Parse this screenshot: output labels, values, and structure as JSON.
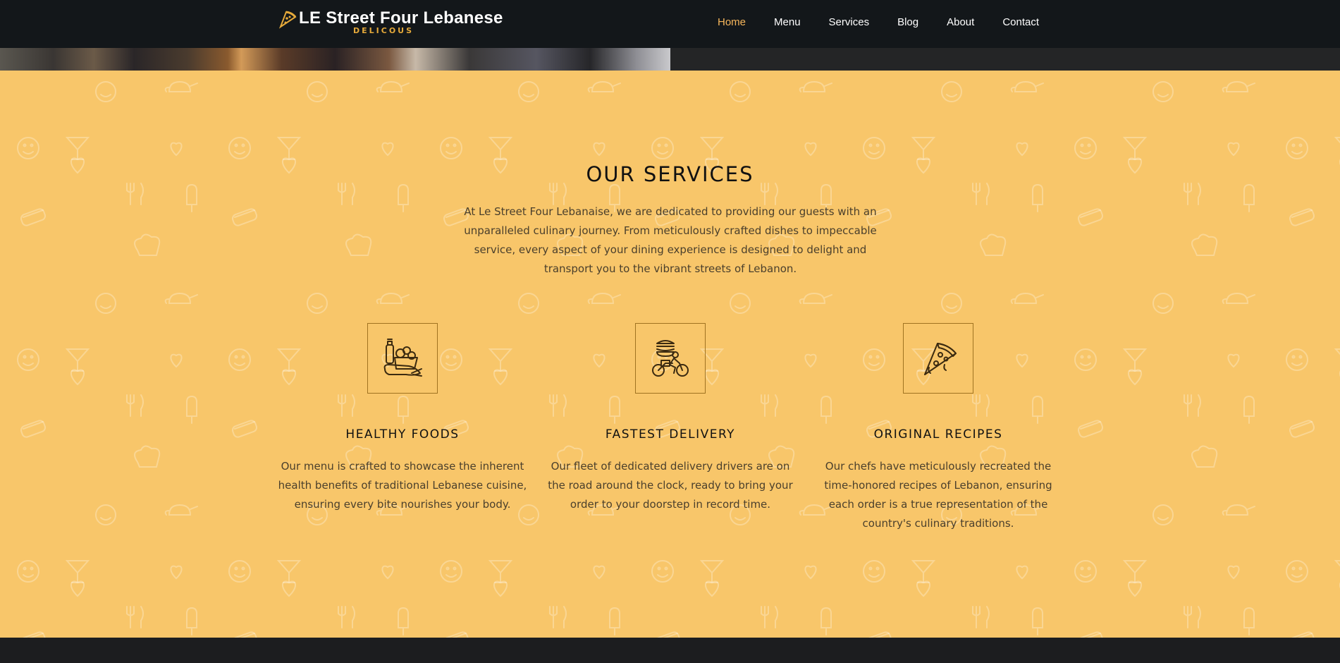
{
  "header": {
    "brand_title": "LE Street Four Lebanese",
    "brand_subtitle": "DELICOUS",
    "nav": [
      {
        "label": "Home",
        "active": true
      },
      {
        "label": "Menu"
      },
      {
        "label": "Services"
      },
      {
        "label": "Blog"
      },
      {
        "label": "About"
      },
      {
        "label": "Contact"
      }
    ]
  },
  "services": {
    "title": "OUR SERVICES",
    "intro": "At Le Street Four Lebanaise, we are dedicated to providing our guests with an unparalleled culinary journey. From meticulously crafted dishes to impeccable service, every aspect of your dining experience is designed to delight and transport you to the vibrant streets of Lebanon.",
    "cards": [
      {
        "icon": "groceries-icon",
        "title": "HEALTHY FOODS",
        "text": "Our menu is crafted to showcase the inherent health benefits of traditional Lebanese cuisine, ensuring every bite nourishes your body."
      },
      {
        "icon": "delivery-bike-icon",
        "title": "FASTEST DELIVERY",
        "text": "Our fleet of dedicated delivery drivers are on the road around the clock, ready to bring your order to your doorstep in record time."
      },
      {
        "icon": "pizza-slice-icon",
        "title": "ORIGINAL RECIPES",
        "text": "Our chefs have meticulously recreated the time-honored recipes of Lebanon, ensuring each order is a true representation of the country's culinary traditions."
      }
    ]
  },
  "colors": {
    "header_bg": "#13171a",
    "accent": "#f7b65b",
    "section_bg": "#f8c66a",
    "icon_stroke": "#3b2a10"
  }
}
